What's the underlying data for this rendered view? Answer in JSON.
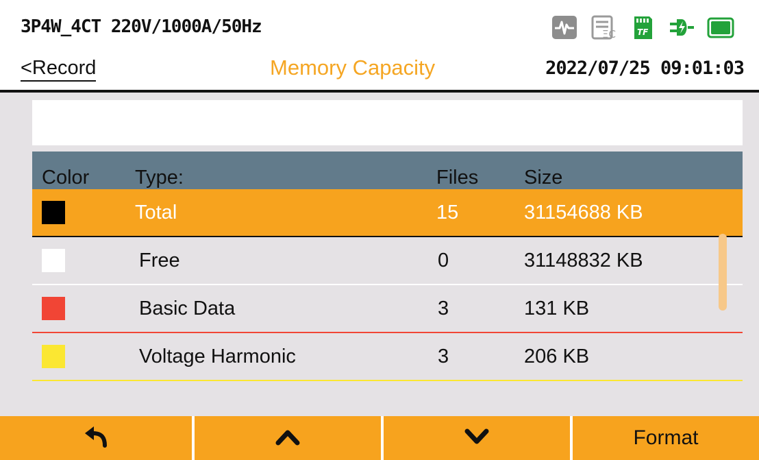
{
  "header": {
    "config": "3P4W_4CT 220V/1000A/50Hz",
    "back_label": "<Record",
    "title": "Memory Capacity",
    "datetime": "2022/07/25 09:01:03",
    "status_icons": [
      "waveform-icon",
      "ec-icon",
      "tf-card-icon",
      "power-plug-icon",
      "battery-icon"
    ],
    "tf_label": "TF"
  },
  "table": {
    "columns": [
      "Color",
      "Type:",
      "Files",
      "Size"
    ],
    "rows": [
      {
        "type": "Total",
        "files": "15",
        "size": "31154688 KB",
        "color": "#000000",
        "selected": true
      },
      {
        "type": "Free",
        "files": "0",
        "size": "31148832 KB",
        "color": "#ffffff",
        "selected": false
      },
      {
        "type": "Basic Data",
        "files": "3",
        "size": "131 KB",
        "color": "#f14535",
        "selected": false
      },
      {
        "type": "Voltage Harmonic",
        "files": "3",
        "size": "206 KB",
        "color": "#fbe732",
        "selected": false
      }
    ]
  },
  "footer": {
    "buttons": [
      "back-arrow-icon",
      "chevron-up-icon",
      "chevron-down-icon",
      "Format"
    ],
    "format_label": "Format"
  },
  "colors": {
    "accent": "#f7a31e",
    "title": "#f5a623",
    "table_header": "#627b8b",
    "content_bg": "#e5e2e5"
  }
}
